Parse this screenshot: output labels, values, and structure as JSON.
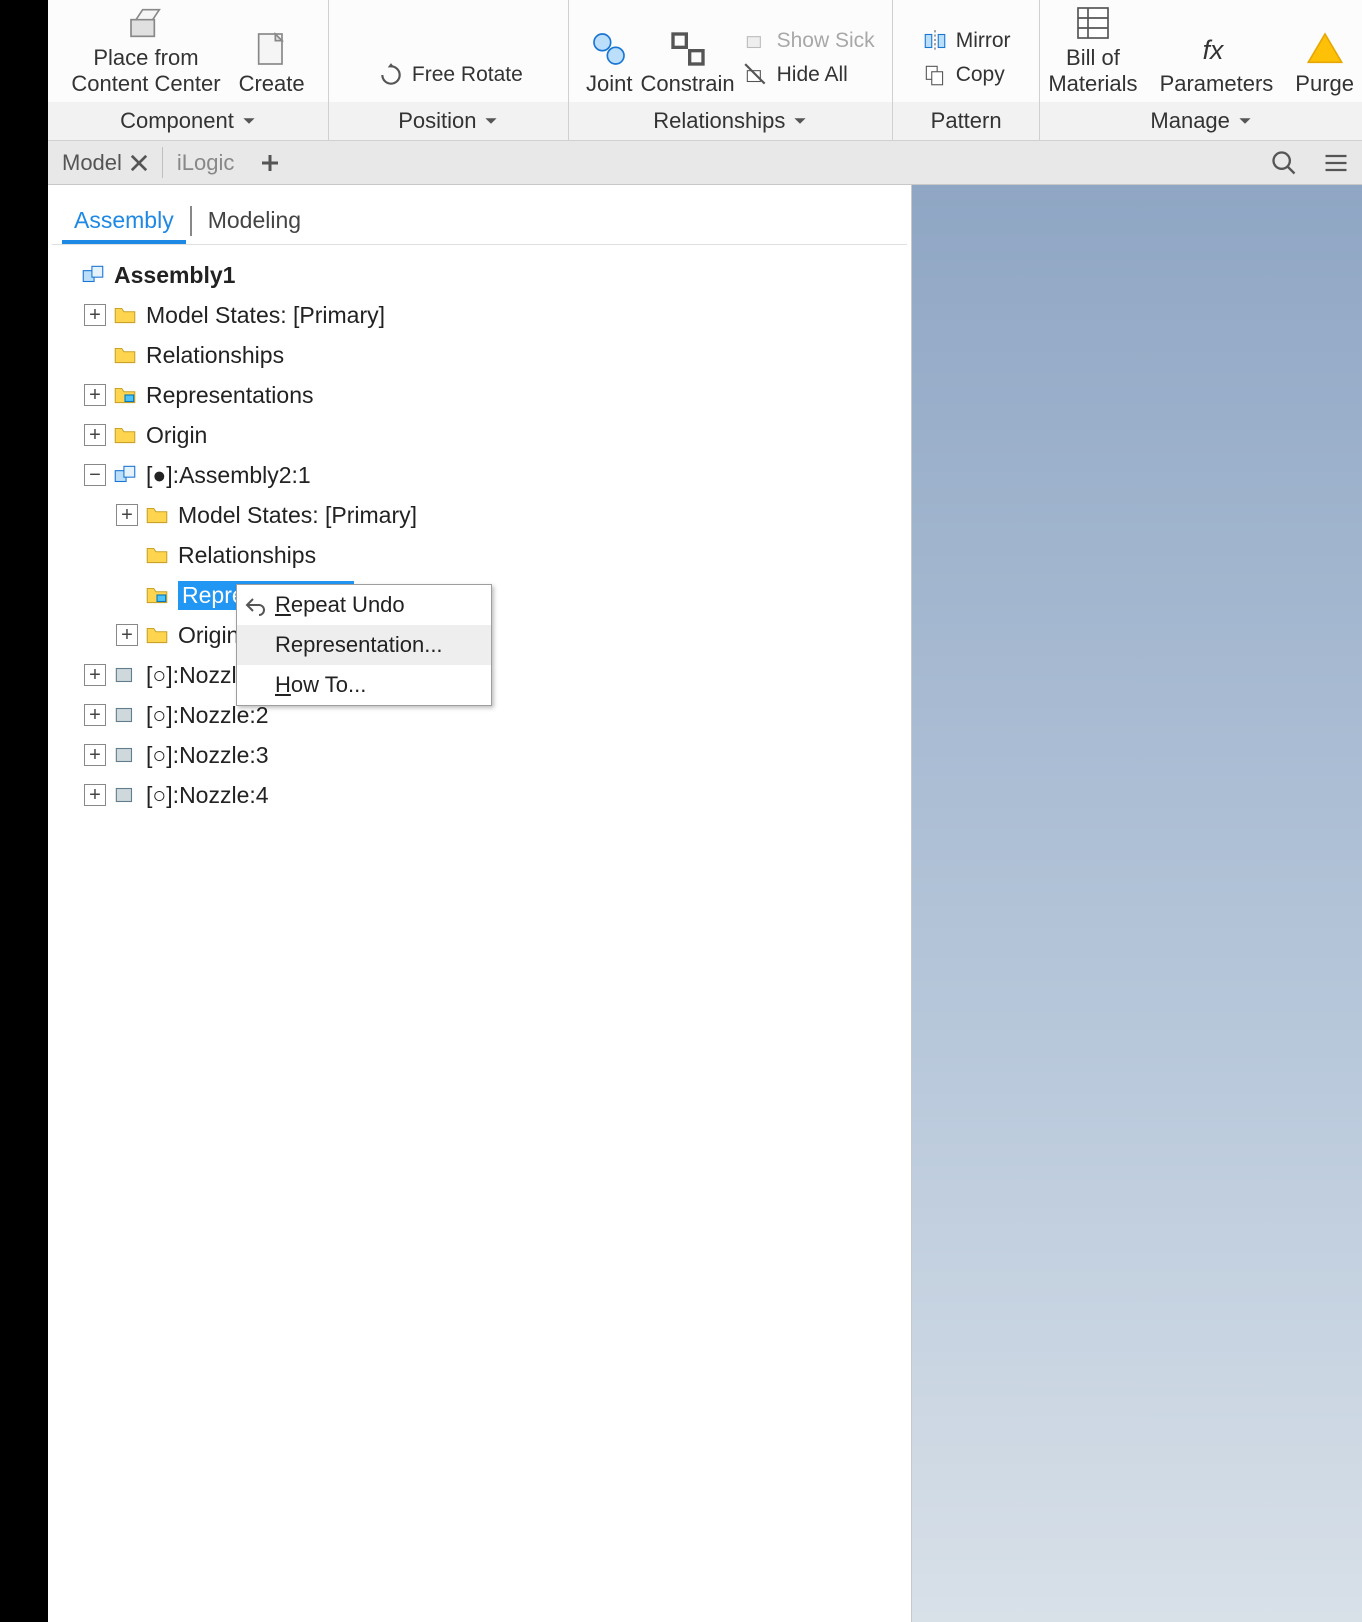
{
  "ribbon": {
    "place_label_l1": "Place from",
    "place_label_l2": "Content Center",
    "create_label": "Create",
    "free_rotate_label": "Free Rotate",
    "joint_label": "Joint",
    "constrain_label": "Constrain",
    "show_sick_label": "Show Sick",
    "hide_all_label": "Hide All",
    "mirror_label": "Mirror",
    "copy_label": "Copy",
    "bom_label_l1": "Bill of",
    "bom_label_l2": "Materials",
    "parameters_label": "Parameters",
    "purge_label": "Purge",
    "group_component": "Component",
    "group_position": "Position",
    "group_relationships": "Relationships",
    "group_pattern": "Pattern",
    "group_manage": "Manage"
  },
  "panel_tabs": {
    "model": "Model",
    "ilogic": "iLogic"
  },
  "subtabs": {
    "assembly": "Assembly",
    "modeling": "Modeling"
  },
  "tree": {
    "root": "Assembly1",
    "items": [
      "Model States: [Primary]",
      "Relationships",
      "Representations",
      "Origin",
      "[●]:Assembly2:1"
    ],
    "sub_items": [
      "Model States: [Primary]",
      "Relationships",
      "Representations",
      "Origin"
    ],
    "nozzles": [
      "[○]:Nozzle:1",
      "[○]:Nozzle:2",
      "[○]:Nozzle:3",
      "[○]:Nozzle:4"
    ]
  },
  "context_menu": {
    "repeat_undo": "Repeat Undo",
    "representation": "Representation...",
    "how_to": "How To..."
  }
}
